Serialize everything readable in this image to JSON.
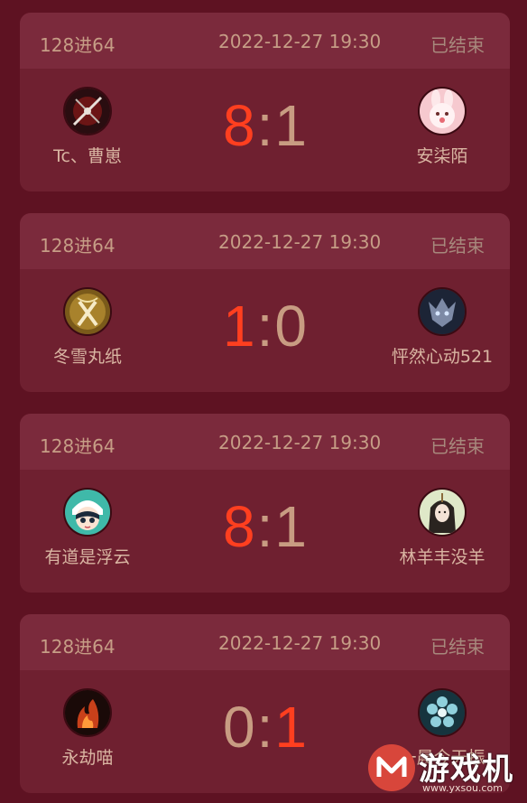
{
  "matches": [
    {
      "round": "128进64",
      "time": "2022-12-27 19:30",
      "status": "已结束",
      "left_player": {
        "name": "Tc、曹崽",
        "avatar_icon": "crossed-swords-avatar-icon"
      },
      "right_player": {
        "name": "安柒陌",
        "avatar_icon": "pink-bunny-avatar-icon"
      },
      "score_left": "8",
      "score_right": "1",
      "winner": "left"
    },
    {
      "round": "128进64",
      "time": "2022-12-27 19:30",
      "status": "已结束",
      "left_player": {
        "name": "冬雪丸纸",
        "avatar_icon": "golden-swords-avatar-icon"
      },
      "right_player": {
        "name": "怦然心动521",
        "avatar_icon": "dragon-mask-avatar-icon"
      },
      "score_left": "1",
      "score_right": "0",
      "winner": "left"
    },
    {
      "round": "128进64",
      "time": "2022-12-27 19:30",
      "status": "已结束",
      "left_player": {
        "name": "有道是浮云",
        "avatar_icon": "cartoon-girl-avatar-icon"
      },
      "right_player": {
        "name": "林羊丰没羊",
        "avatar_icon": "long-hair-girl-avatar-icon"
      },
      "score_left": "8",
      "score_right": "1",
      "winner": "left"
    },
    {
      "round": "128进64",
      "time": "2022-12-27 19:30",
      "status": "已结束",
      "left_player": {
        "name": "永劫喵",
        "avatar_icon": "fire-avatar-icon"
      },
      "right_player": {
        "name": "一晨今天振",
        "avatar_icon": "blue-flower-avatar-icon"
      },
      "score_left": "0",
      "score_right": "1",
      "winner": "right"
    }
  ],
  "watermark": {
    "text": "游戏机",
    "url": "www.yxsou.com",
    "logo_icon": "m-logo-icon"
  },
  "colors": {
    "page_bg": "#5e1222",
    "card_bg": "#6f2030",
    "header_bg": "#7b2a3c",
    "win_score": "#ff3f1f",
    "lose_score": "#c89c82"
  }
}
